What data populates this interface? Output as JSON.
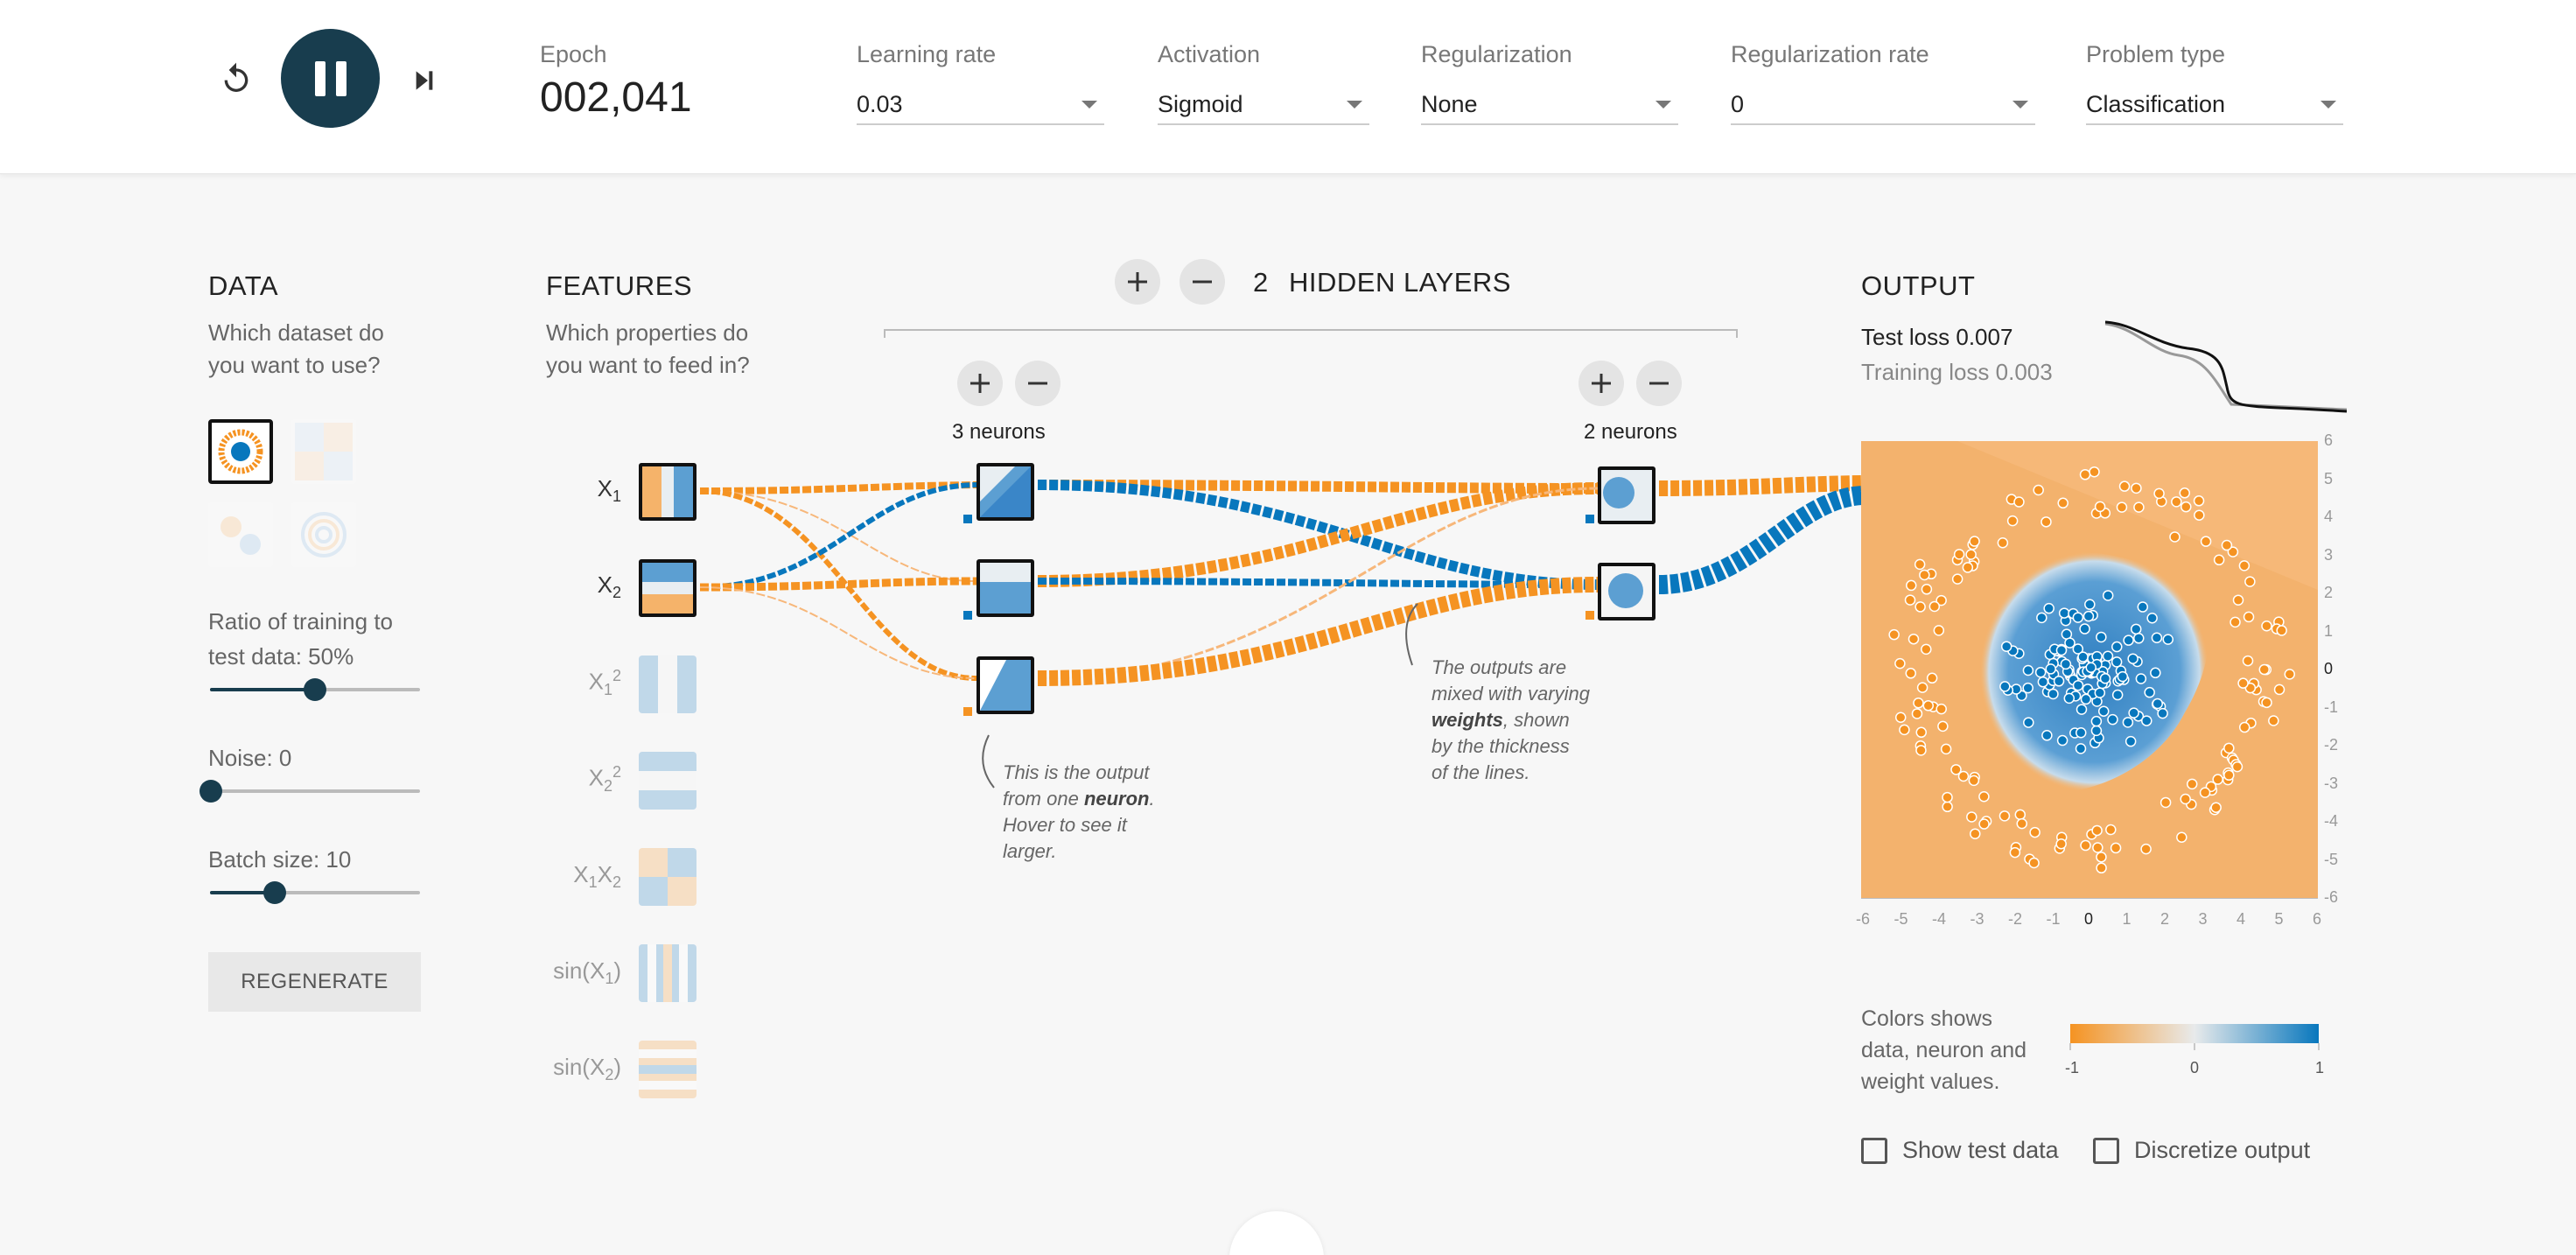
{
  "controls": {
    "reset_icon": "reset-icon",
    "pause_icon": "pause-icon",
    "step_icon": "step-forward-icon",
    "epoch_label": "Epoch",
    "epoch_value": "002,041",
    "learning_rate": {
      "label": "Learning rate",
      "value": "0.03"
    },
    "activation": {
      "label": "Activation",
      "value": "Sigmoid"
    },
    "regularization": {
      "label": "Regularization",
      "value": "None"
    },
    "regularization_rate": {
      "label": "Regularization rate",
      "value": "0"
    },
    "problem_type": {
      "label": "Problem type",
      "value": "Classification"
    }
  },
  "data_panel": {
    "title": "DATA",
    "subtitle_1": "Which dataset do",
    "subtitle_2": "you want to use?",
    "ratio_label_1": "Ratio of training to",
    "ratio_label_2": "test data:  50%",
    "ratio_value": 0.5,
    "noise_label": "Noise:  0",
    "noise_value": 0,
    "batch_label": "Batch size:  10",
    "batch_value": 10,
    "batch_fraction": 0.3,
    "regenerate": "REGENERATE"
  },
  "features_panel": {
    "title": "FEATURES",
    "subtitle_1": "Which properties do",
    "subtitle_2": "you want to feed in?",
    "features": [
      {
        "base": "X",
        "sub": "1",
        "sup": "",
        "active": true
      },
      {
        "base": "X",
        "sub": "2",
        "sup": "",
        "active": true
      },
      {
        "base": "X",
        "sub": "1",
        "sup": "2",
        "active": false
      },
      {
        "base": "X",
        "sub": "2",
        "sup": "2",
        "active": false
      },
      {
        "base": "X",
        "sub": "1",
        "sup": "",
        "base2": "X",
        "sub2": "2",
        "active": false
      },
      {
        "base": "sin(X",
        "sub": "1",
        "sup": "",
        "tail": ")",
        "active": false
      },
      {
        "base": "sin(X",
        "sub": "2",
        "sup": "",
        "tail": ")",
        "active": false
      }
    ]
  },
  "network": {
    "add_icon": "plus-icon",
    "remove_icon": "minus-icon",
    "layer_count": "2",
    "layers_title": "HIDDEN LAYERS",
    "layer1_neurons": "3 neurons",
    "layer2_neurons": "2 neurons",
    "note_neuron": {
      "l1": "This is the output",
      "l2a": "from one ",
      "l2b": "neuron",
      "l2c": ".",
      "l3": "Hover to see it",
      "l4": "larger."
    },
    "note_weights": {
      "l1": "The outputs are",
      "l2": "mixed with varying",
      "l3a": "weights",
      "l3b": ", shown",
      "l4": "by the thickness",
      "l5": "of the lines."
    }
  },
  "output_panel": {
    "title": "OUTPUT",
    "test_loss_label": "Test loss ",
    "test_loss": "0.007",
    "training_loss_label": "Training loss ",
    "training_loss": "0.003",
    "y_ticks": [
      "6",
      "5",
      "4",
      "3",
      "2",
      "1",
      "0",
      "-1",
      "-2",
      "-3",
      "-4",
      "-5",
      "-6"
    ],
    "x_ticks": [
      "-6",
      "-5",
      "-4",
      "-3",
      "-2",
      "-1",
      "0",
      "1",
      "2",
      "3",
      "4",
      "5",
      "6"
    ],
    "legend_text_1": "Colors shows",
    "legend_text_2": "data, neuron and",
    "legend_text_3": "weight values.",
    "legend_ticks": [
      "-1",
      "0",
      "1"
    ],
    "show_test_data": "Show test data",
    "discretize_output": "Discretize output"
  },
  "colors": {
    "orange": "#f59322",
    "blue": "#0877bd",
    "dark": "#183d4e"
  }
}
